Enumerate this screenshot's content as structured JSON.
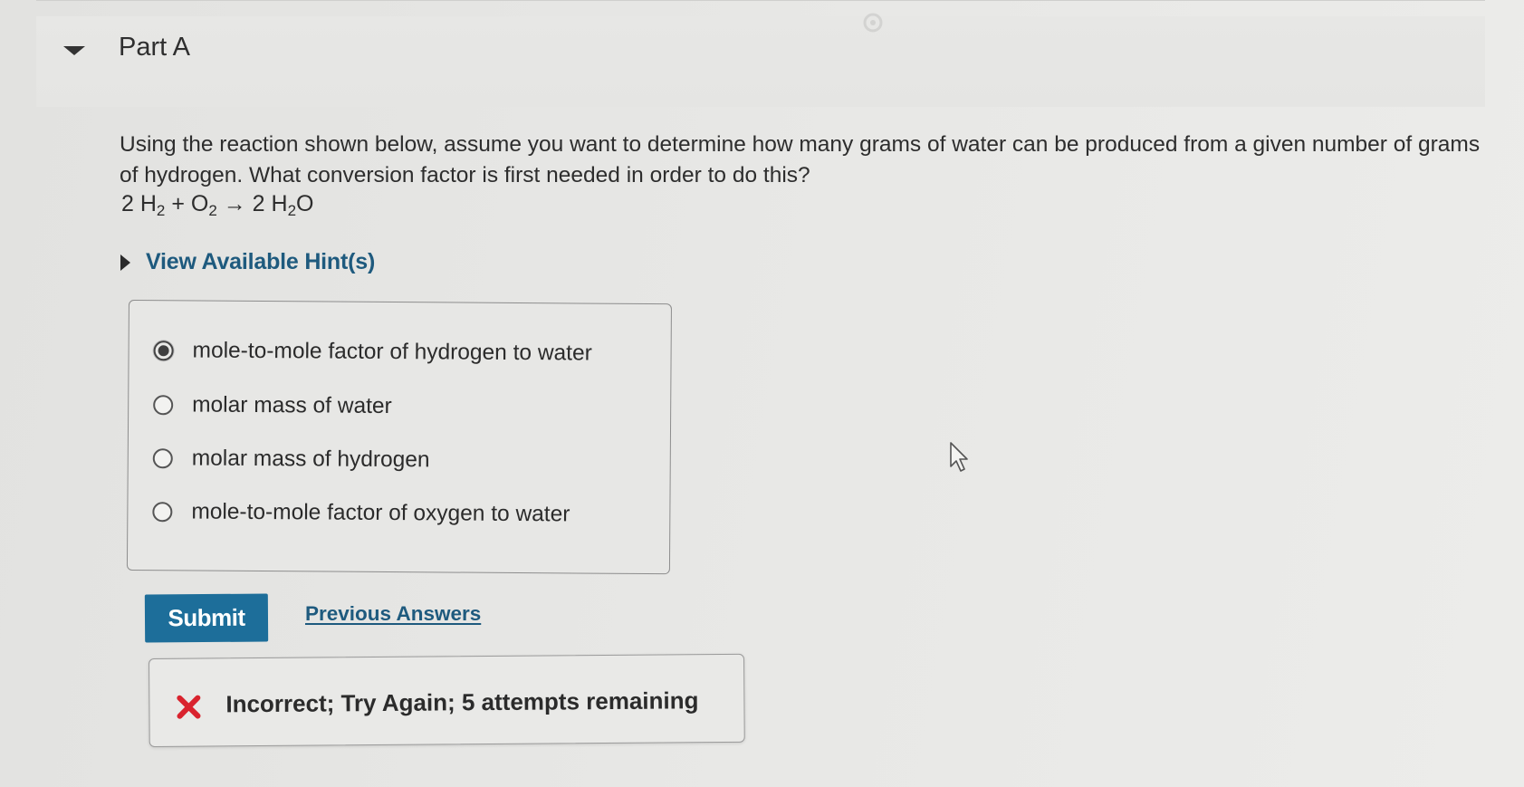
{
  "part": {
    "title": "Part A"
  },
  "question": {
    "text": "Using the reaction shown below, assume you want to determine how many grams of water can be produced from a given number of grams of hydrogen. What conversion factor is first needed in order to do this?",
    "equation": {
      "coef1": "2 H",
      "sub1": "2",
      "plus": " + O",
      "sub2": "2",
      "arrow": " → 2 H",
      "sub3": "2",
      "tail": "O"
    }
  },
  "hint": {
    "label": "View Available Hint(s)"
  },
  "choices": [
    {
      "label": "mole-to-mole factor of hydrogen to water",
      "selected": true
    },
    {
      "label": "molar mass of water",
      "selected": false
    },
    {
      "label": "molar mass of hydrogen",
      "selected": false
    },
    {
      "label": "mole-to-mole factor of oxygen to water",
      "selected": false
    }
  ],
  "actions": {
    "submit_label": "Submit",
    "previous_answers_label": "Previous Answers"
  },
  "feedback": {
    "text": "Incorrect; Try Again; 5 attempts remaining",
    "icon": "x-icon",
    "icon_color": "#d9232e"
  },
  "colors": {
    "link": "#1e5a7e",
    "submit_bg": "#1d6e9a"
  }
}
